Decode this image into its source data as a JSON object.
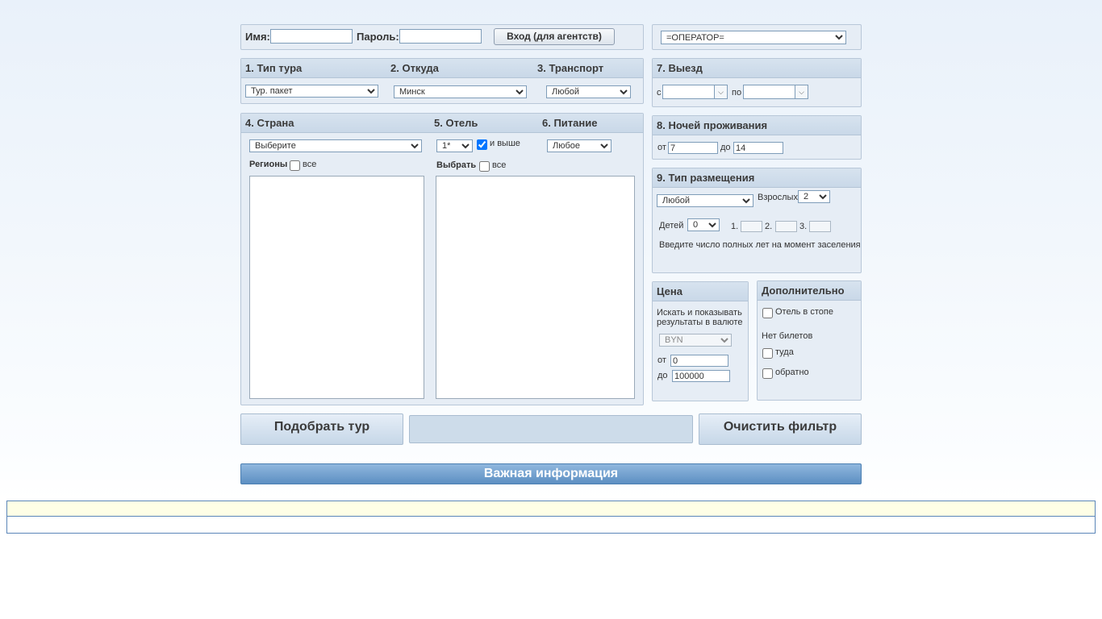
{
  "login": {
    "name_label": "Имя:",
    "password_label": "Пароль:",
    "login_button": "Вход (для агентств)",
    "operator_select": "=ОПЕРАТОР="
  },
  "tour_type": {
    "title": "1. Тип тура",
    "value": "Тур. пакет"
  },
  "departure_from": {
    "title": "2. Откуда",
    "value": "Минск"
  },
  "transport": {
    "title": "3. Транспорт",
    "value": "Любой"
  },
  "departure_date": {
    "title": "7. Выезд",
    "from_label": "с",
    "to_label": "по"
  },
  "country": {
    "title": "4. Страна",
    "value": "Выберите",
    "regions_label": "Регионы",
    "all_label": "все"
  },
  "hotel": {
    "title": "5. Отель",
    "stars_value": "1*",
    "and_higher_label": "и выше",
    "select_label": "Выбрать",
    "all_label": "все"
  },
  "meals": {
    "title": "6. Питание",
    "value": "Любое"
  },
  "nights": {
    "title": "8. Ночей проживания",
    "from_label": "от",
    "from_value": "7",
    "to_label": "до",
    "to_value": "14"
  },
  "accommodation": {
    "title": "9. Тип размещения",
    "room_value": "Любой",
    "adults_label": "Взрослых",
    "adults_value": "2",
    "children_label": "Детей",
    "children_value": "0",
    "child1_label": "1.",
    "child2_label": "2.",
    "child3_label": "3.",
    "age_hint": "Введите число полных лет на момент заселения"
  },
  "price": {
    "title": "Цена",
    "currency_hint": "Искать и показывать результаты в валюте",
    "currency_value": "BYN",
    "from_label": "от",
    "from_value": "0",
    "to_label": "до",
    "to_value": "100000"
  },
  "extra": {
    "title": "Дополнительно",
    "hotel_stop_label": "Отель в стопе",
    "no_tickets_label": "Нет билетов",
    "there_label": "туда",
    "back_label": "обратно"
  },
  "actions": {
    "search_button": "Подобрать тур",
    "clear_button": "Очистить фильтр"
  },
  "info_bar": "Важная информация"
}
